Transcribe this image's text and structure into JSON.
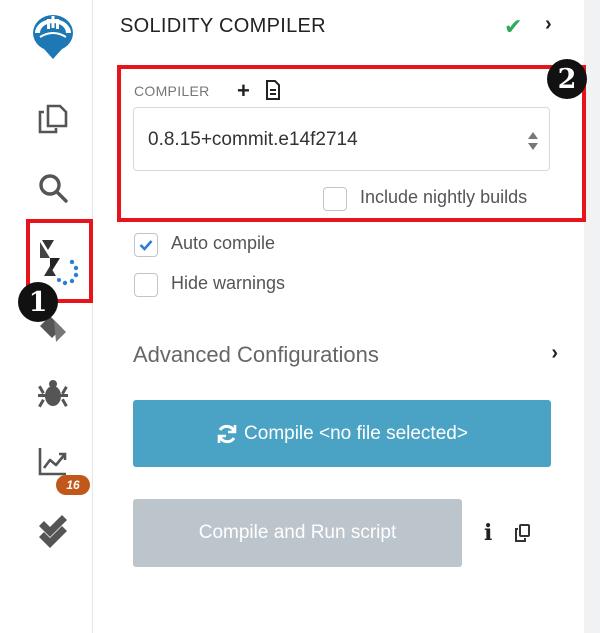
{
  "panel": {
    "title": "SOLIDITY COMPILER",
    "status_icon": "check-icon",
    "expand_icon": "chevron-right-icon"
  },
  "compiler": {
    "label": "COMPILER",
    "add_icon": "plus-icon",
    "doc_icon": "document-icon",
    "selected_version": "0.8.15+commit.e14f2714",
    "include_nightly_label": "Include nightly builds",
    "include_nightly_checked": false
  },
  "options": {
    "auto_compile_label": "Auto compile",
    "auto_compile_checked": true,
    "hide_warnings_label": "Hide warnings",
    "hide_warnings_checked": false
  },
  "advanced": {
    "label": "Advanced Configurations"
  },
  "buttons": {
    "compile_label": "Compile <no file selected>",
    "run_script_label": "Compile and Run script",
    "info_icon": "info-icon",
    "copy_icon": "copy-icon"
  },
  "rail": {
    "items": [
      "home-logo-icon",
      "file-explorer-icon",
      "search-icon",
      "solidity-compiler-icon",
      "deploy-run-icon",
      "debugger-icon",
      "analysis-icon",
      "tests-icon"
    ],
    "analysis_badge": "16"
  },
  "annotations": {
    "marker_1": "1",
    "marker_2": "2"
  },
  "colors": {
    "accent": "#4aa3c4",
    "success": "#2eaa5a",
    "annotation": "#e8141b",
    "badge": "#c2571a",
    "disabled": "#bcc4cc"
  }
}
